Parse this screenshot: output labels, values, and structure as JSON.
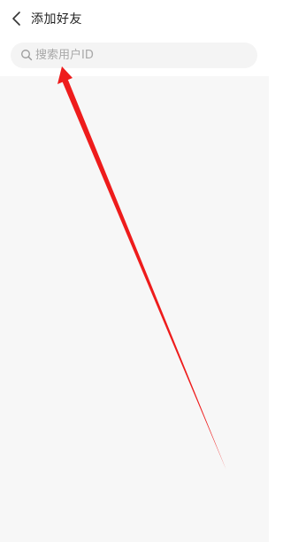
{
  "header": {
    "title": "添加好友",
    "back_icon": "chevron-left-icon"
  },
  "search": {
    "placeholder": "搜索用户ID",
    "value": "",
    "icon": "search-icon"
  },
  "annotation": {
    "type": "arrow",
    "color": "#ee1c1c",
    "points_to": "search-input"
  }
}
